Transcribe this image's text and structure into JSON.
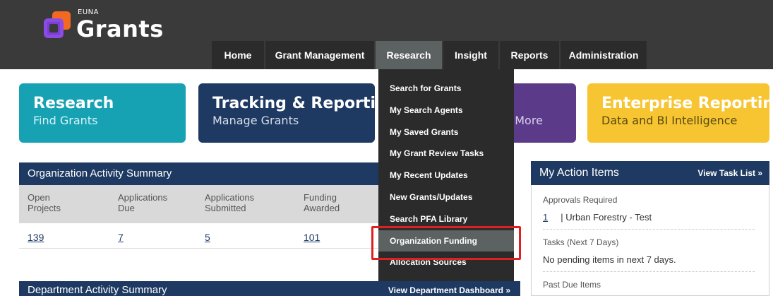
{
  "header": {
    "brand_small": "EUNA",
    "brand_name": "Grants",
    "nav": [
      {
        "label": "Home"
      },
      {
        "label": "Grant Management"
      },
      {
        "label": "Research",
        "active": true
      },
      {
        "label": "Insight"
      },
      {
        "label": "Reports"
      },
      {
        "label": "Administration"
      }
    ]
  },
  "tiles": {
    "research": {
      "title": "Research",
      "subtitle": "Find Grants"
    },
    "tracking": {
      "title": "Tracking & Reporting",
      "subtitle": "Manage Grants"
    },
    "insight": {
      "subtitle_partial": "d More"
    },
    "enterprise": {
      "title": "Enterprise Reporting",
      "subtitle": "Data and BI Intelligence"
    }
  },
  "org_summary": {
    "title": "Organization Activity Summary",
    "columns": [
      {
        "label_line1": "Open",
        "label_line2": "Projects",
        "value": "139"
      },
      {
        "label_line1": "Applications",
        "label_line2": "Due",
        "value": "7"
      },
      {
        "label_line1": "Applications",
        "label_line2": "Submitted",
        "value": "5"
      },
      {
        "label_line1": "Funding",
        "label_line2": "Awarded",
        "value": "101"
      }
    ]
  },
  "dept_summary": {
    "title": "Department Activity Summary",
    "link": "View Department Dashboard »"
  },
  "action_items": {
    "title": "My Action Items",
    "link": "View Task List »",
    "approvals_label": "Approvals Required",
    "approvals_count": "1",
    "approvals_item": "| Urban Forestry - Test",
    "tasks_label": "Tasks (Next 7 Days)",
    "tasks_text": "No pending items in next 7 days.",
    "past_due_label": "Past Due Items"
  },
  "research_menu": {
    "items": [
      "Search for Grants",
      "My Search Agents",
      "My Saved Grants",
      "My Grant Review Tasks",
      "My Recent Updates",
      "New Grants/Updates",
      "Search PFA Library",
      "Organization Funding",
      "Allocation Sources"
    ],
    "highlighted_index": 7
  },
  "colors": {
    "topbar": "#3a3a3a",
    "nav_active": "#5c6161",
    "navy": "#1e3a63",
    "teal": "#17a2b3",
    "purple": "#5b3a8a",
    "yellow": "#f7c531",
    "highlight_border": "#e02020"
  }
}
